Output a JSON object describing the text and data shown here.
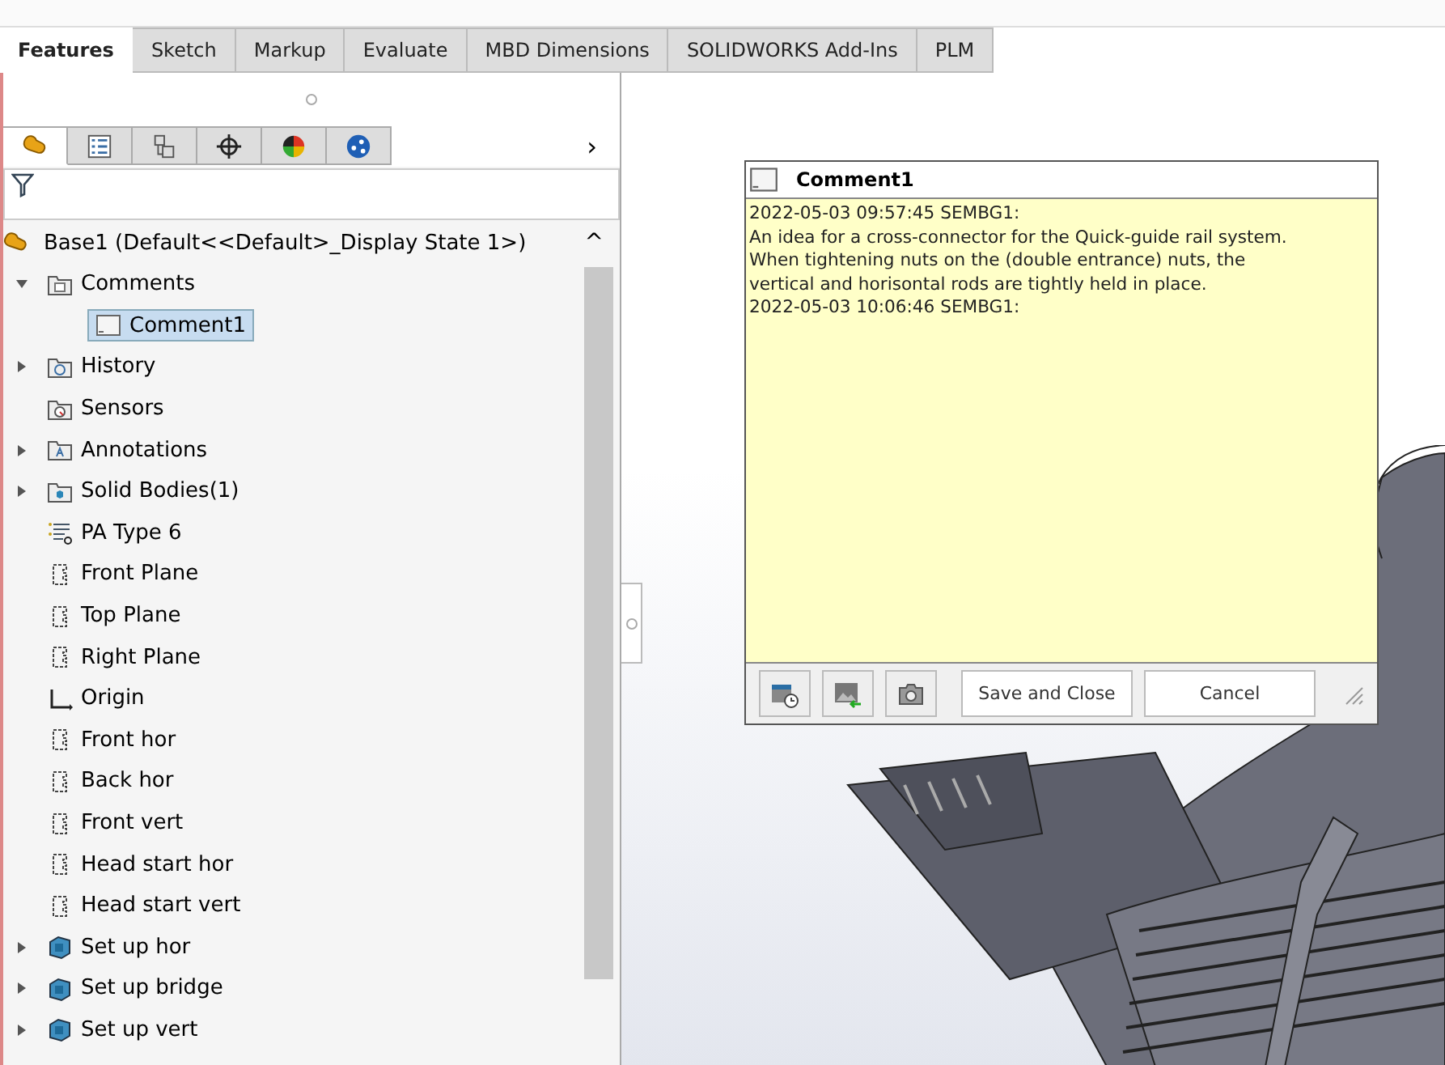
{
  "tabs": [
    {
      "label": "Features",
      "selected": true
    },
    {
      "label": "Sketch",
      "selected": false
    },
    {
      "label": "Markup",
      "selected": false
    },
    {
      "label": "Evaluate",
      "selected": false
    },
    {
      "label": "MBD Dimensions",
      "selected": false
    },
    {
      "label": "SOLIDWORKS Add-Ins",
      "selected": false
    },
    {
      "label": "PLM",
      "selected": false
    }
  ],
  "panel_tabs": [
    {
      "kind": "feature",
      "selected": true
    },
    {
      "kind": "property",
      "selected": false
    },
    {
      "kind": "config",
      "selected": false
    },
    {
      "kind": "dimxpert",
      "selected": false
    },
    {
      "kind": "display",
      "selected": false
    },
    {
      "kind": "network",
      "selected": false
    }
  ],
  "panel_more": "›",
  "tree": {
    "root": {
      "label": "Base1  (Default<<Default>_Display State 1>)",
      "scroll_up": "^"
    },
    "items": [
      {
        "label": "Comments",
        "kind": "folder",
        "expanded": true,
        "selected": false,
        "children": [
          {
            "label": "Comment1",
            "kind": "comment",
            "selected": true
          }
        ]
      },
      {
        "label": "History",
        "kind": "history",
        "expanded": false,
        "selected": false
      },
      {
        "label": "Sensors",
        "kind": "sensors",
        "selected": false
      },
      {
        "label": "Annotations",
        "kind": "annotations",
        "expanded": false,
        "selected": false
      },
      {
        "label": "Solid Bodies(1)",
        "kind": "bodies",
        "expanded": false,
        "selected": false
      },
      {
        "label": "PA Type 6",
        "kind": "material",
        "selected": false
      },
      {
        "label": "Front Plane",
        "kind": "plane",
        "selected": false
      },
      {
        "label": "Top Plane",
        "kind": "plane",
        "selected": false
      },
      {
        "label": "Right Plane",
        "kind": "plane",
        "selected": false
      },
      {
        "label": "Origin",
        "kind": "origin",
        "selected": false
      },
      {
        "label": "Front hor",
        "kind": "plane",
        "selected": false
      },
      {
        "label": "Back hor",
        "kind": "plane",
        "selected": false
      },
      {
        "label": "Front vert",
        "kind": "plane",
        "selected": false
      },
      {
        "label": "Head start hor",
        "kind": "plane",
        "selected": false
      },
      {
        "label": "Head start vert",
        "kind": "plane",
        "selected": false
      },
      {
        "label": "Set up hor",
        "kind": "part",
        "expanded": false,
        "selected": false
      },
      {
        "label": "Set up bridge",
        "kind": "part",
        "expanded": false,
        "selected": false
      },
      {
        "label": "Set up vert",
        "kind": "part",
        "expanded": false,
        "selected": false
      }
    ]
  },
  "comment_dialog": {
    "title": "Comment1",
    "lines": [
      "2022-05-03 09:57:45 SEMBG1:",
      "An idea for a cross-connector for the Quick-guide rail system.",
      "When tightening nuts on the (double entrance) nuts, the",
      "vertical and horisontal rods are tightly held in place.",
      "2022-05-03 10:06:46 SEMBG1:"
    ],
    "tools": [
      {
        "kind": "timestamp"
      },
      {
        "kind": "image"
      },
      {
        "kind": "camera"
      }
    ],
    "buttons": [
      "Save and Close",
      "Cancel"
    ]
  }
}
